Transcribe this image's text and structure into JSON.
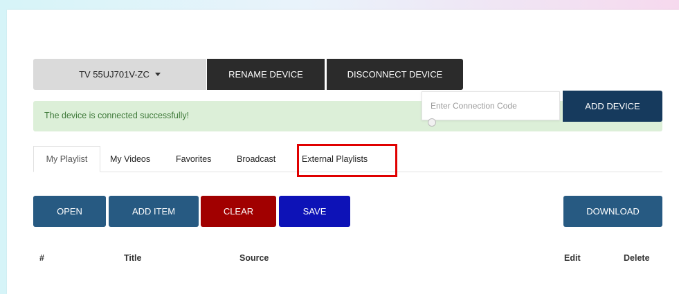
{
  "device": {
    "selected": "TV 55UJ701V-ZC"
  },
  "toolbar": {
    "rename_label": "RENAME DEVICE",
    "disconnect_label": "DISCONNECT DEVICE"
  },
  "alert": {
    "success_message": "The device is connected successfully!"
  },
  "connect": {
    "placeholder": "Enter Connection Code",
    "value": "",
    "add_label": "ADD DEVICE"
  },
  "tabs": [
    {
      "label": "My Playlist",
      "active": true
    },
    {
      "label": "My Videos"
    },
    {
      "label": "Favorites"
    },
    {
      "label": "Broadcast"
    },
    {
      "label": "External Playlists",
      "highlighted": true
    }
  ],
  "actions": {
    "open": "OPEN",
    "add_item": "ADD ITEM",
    "clear": "CLEAR",
    "save": "SAVE",
    "download": "DOWNLOAD"
  },
  "table": {
    "columns": [
      "#",
      "Title",
      "Source",
      "Edit",
      "Delete"
    ]
  },
  "colors": {
    "primary": "#275a82",
    "add_device": "#163a5d",
    "clear": "#a10000",
    "save": "#0d12b7",
    "dark": "#2b2b2b",
    "success_bg": "#dcefd8",
    "highlight": "#e00000"
  }
}
